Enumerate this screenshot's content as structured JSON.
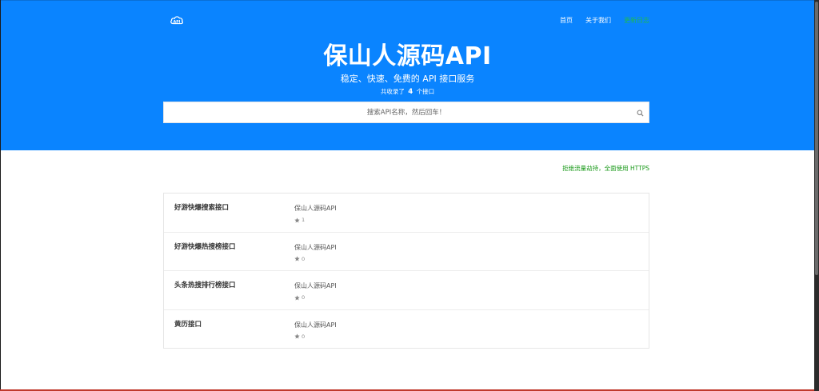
{
  "brand": {
    "logo_icon": "cloud-api-icon",
    "logo_text": "API"
  },
  "nav": [
    {
      "label": "首页",
      "active": false
    },
    {
      "label": "关于我们",
      "active": false
    },
    {
      "label": "更新日志",
      "active": true
    }
  ],
  "hero": {
    "title": "保山人源码API",
    "subtitle": "稳定、快速、免费的 API 接口服务",
    "count_prefix": "共收录了",
    "count_value": "4",
    "count_suffix": "个接口"
  },
  "search": {
    "placeholder": "搜索API名称，然后回车！",
    "value": "",
    "icon": "search-icon"
  },
  "notice": "拒绝流量劫持，全面使用 HTTPS",
  "apis": [
    {
      "name": "好游快爆搜索接口",
      "author": "保山人源码API",
      "stars": "1"
    },
    {
      "name": "好游快爆热搜榜接口",
      "author": "保山人源码API",
      "stars": "0"
    },
    {
      "name": "头条热搜排行榜接口",
      "author": "保山人源码API",
      "stars": "0"
    },
    {
      "name": "黄历接口",
      "author": "保山人源码API",
      "stars": "0"
    }
  ],
  "colors": {
    "hero_bg": "#0a84ff",
    "nav_active": "#1db954",
    "notice": "#1a9a1a",
    "text": "#333333"
  }
}
